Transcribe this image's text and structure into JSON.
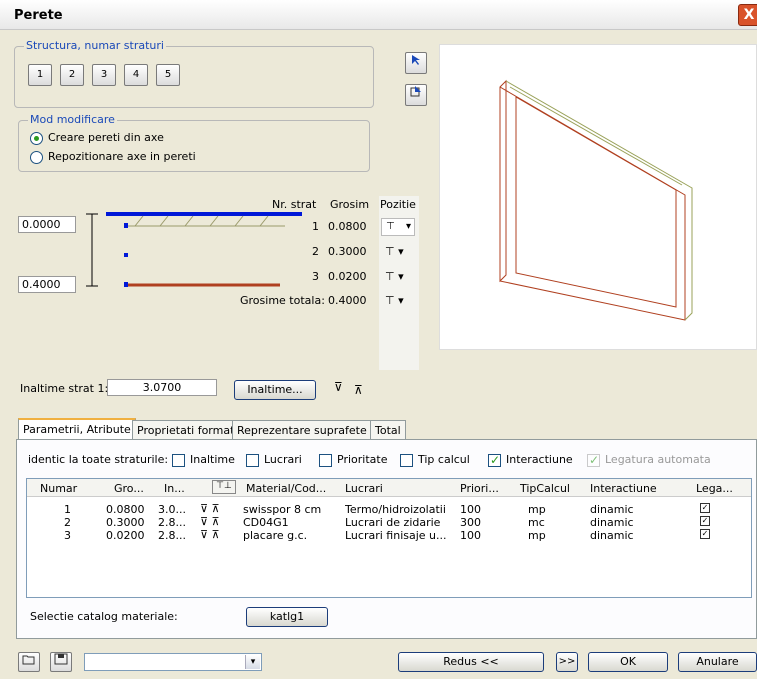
{
  "window": {
    "title": "Perete",
    "close": "X"
  },
  "structure": {
    "label": "Structura, numar straturi",
    "buttons": [
      "1",
      "2",
      "3",
      "4",
      "5"
    ]
  },
  "mode": {
    "label": "Mod modificare",
    "options": [
      "Creare pereti din axe",
      "Repozitionare axe in pereti"
    ],
    "selected": 0
  },
  "layers": {
    "headers": {
      "nr": "Nr. strat",
      "thickness": "Grosim",
      "position": "Pozitie"
    },
    "rows": [
      {
        "nr": "1",
        "thickness": "0.0800"
      },
      {
        "nr": "2",
        "thickness": "0.3000"
      },
      {
        "nr": "3",
        "thickness": "0.0200"
      }
    ],
    "total_label": "Grosime totala:",
    "total_value": "0.4000",
    "top_value": "0.0000",
    "bottom_value": "0.4000"
  },
  "height": {
    "label": "Inaltime strat 1:",
    "value": "3.0700",
    "button": "Inaltime..."
  },
  "tabs": [
    "Parametrii, Atribute",
    "Proprietati format",
    "Reprezentare suprafete",
    "Total"
  ],
  "identic": {
    "label": "identic la toate straturile:",
    "options": [
      {
        "label": "Inaltime",
        "checked": false
      },
      {
        "label": "Lucrari",
        "checked": false
      },
      {
        "label": "Prioritate",
        "checked": false
      },
      {
        "label": "Tip calcul",
        "checked": false
      },
      {
        "label": "Interactiune",
        "checked": true
      },
      {
        "label": "Legatura automata",
        "checked": true,
        "disabled": true
      }
    ]
  },
  "table": {
    "headers": [
      "Numar",
      "Gro...",
      "In...",
      "",
      "Material/Cod...",
      "Lucrari",
      "Priori...",
      "TipCalcul",
      "Interactiune",
      "Lega..."
    ],
    "rows": [
      [
        "1",
        "0.0800",
        "3.0...",
        "swisspor 8 cm",
        "Termo/hidroizolatii",
        "100",
        "mp",
        "dinamic"
      ],
      [
        "2",
        "0.3000",
        "2.8...",
        "CD04G1",
        "Lucrari de zidarie",
        "300",
        "mc",
        "dinamic"
      ],
      [
        "3",
        "0.0200",
        "2.8...",
        "placare g.c.",
        "Lucrari finisaje u...",
        "100",
        "mp",
        "dinamic"
      ]
    ]
  },
  "catalog": {
    "label": "Selectie catalog materiale:",
    "button": "katlg1"
  },
  "footer": {
    "reduce": "Redus <<",
    "more": ">>",
    "ok": "OK",
    "cancel": "Anulare"
  }
}
